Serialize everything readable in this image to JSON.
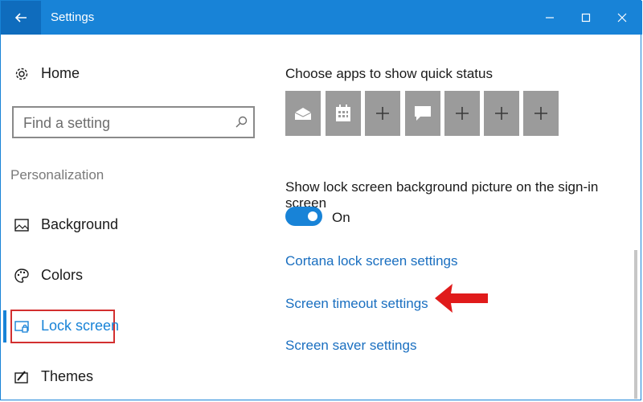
{
  "window": {
    "title": "Settings"
  },
  "icons": {
    "back": "arrow-left-icon",
    "minimize": "minimize-icon",
    "maximize": "maximize-icon",
    "close": "close-icon",
    "home": "gear-icon",
    "search": "search-icon",
    "background": "image-icon",
    "colors": "palette-icon",
    "lock_screen": "lock-screen-icon",
    "themes": "themes-icon",
    "mail_tile": "mail-icon",
    "calendar_tile": "calendar-icon",
    "message_tile": "chat-bubble-icon",
    "plus": "plus-icon",
    "annotation": "red-arrow-icon"
  },
  "colors": {
    "accent": "#1883d7",
    "link": "#1a6fc0",
    "highlight_box": "#d32f2f",
    "tile": "#9b9b9b"
  },
  "sidebar": {
    "home_label": "Home",
    "search_placeholder": "Find a setting",
    "section_label": "Personalization",
    "items": [
      {
        "label": "Background"
      },
      {
        "label": "Colors"
      },
      {
        "label": "Lock screen"
      },
      {
        "label": "Themes"
      }
    ],
    "selected_item": "Lock screen"
  },
  "main": {
    "quick_status_heading": "Choose apps to show quick status",
    "quick_status_tiles": [
      "mail",
      "calendar",
      "plus",
      "message",
      "plus",
      "plus",
      "plus"
    ],
    "signin_heading": "Show lock screen background picture on the sign-in screen",
    "toggle_state": "On",
    "links": {
      "cortana": "Cortana lock screen settings",
      "timeout": "Screen timeout settings",
      "saver": "Screen saver settings"
    }
  }
}
